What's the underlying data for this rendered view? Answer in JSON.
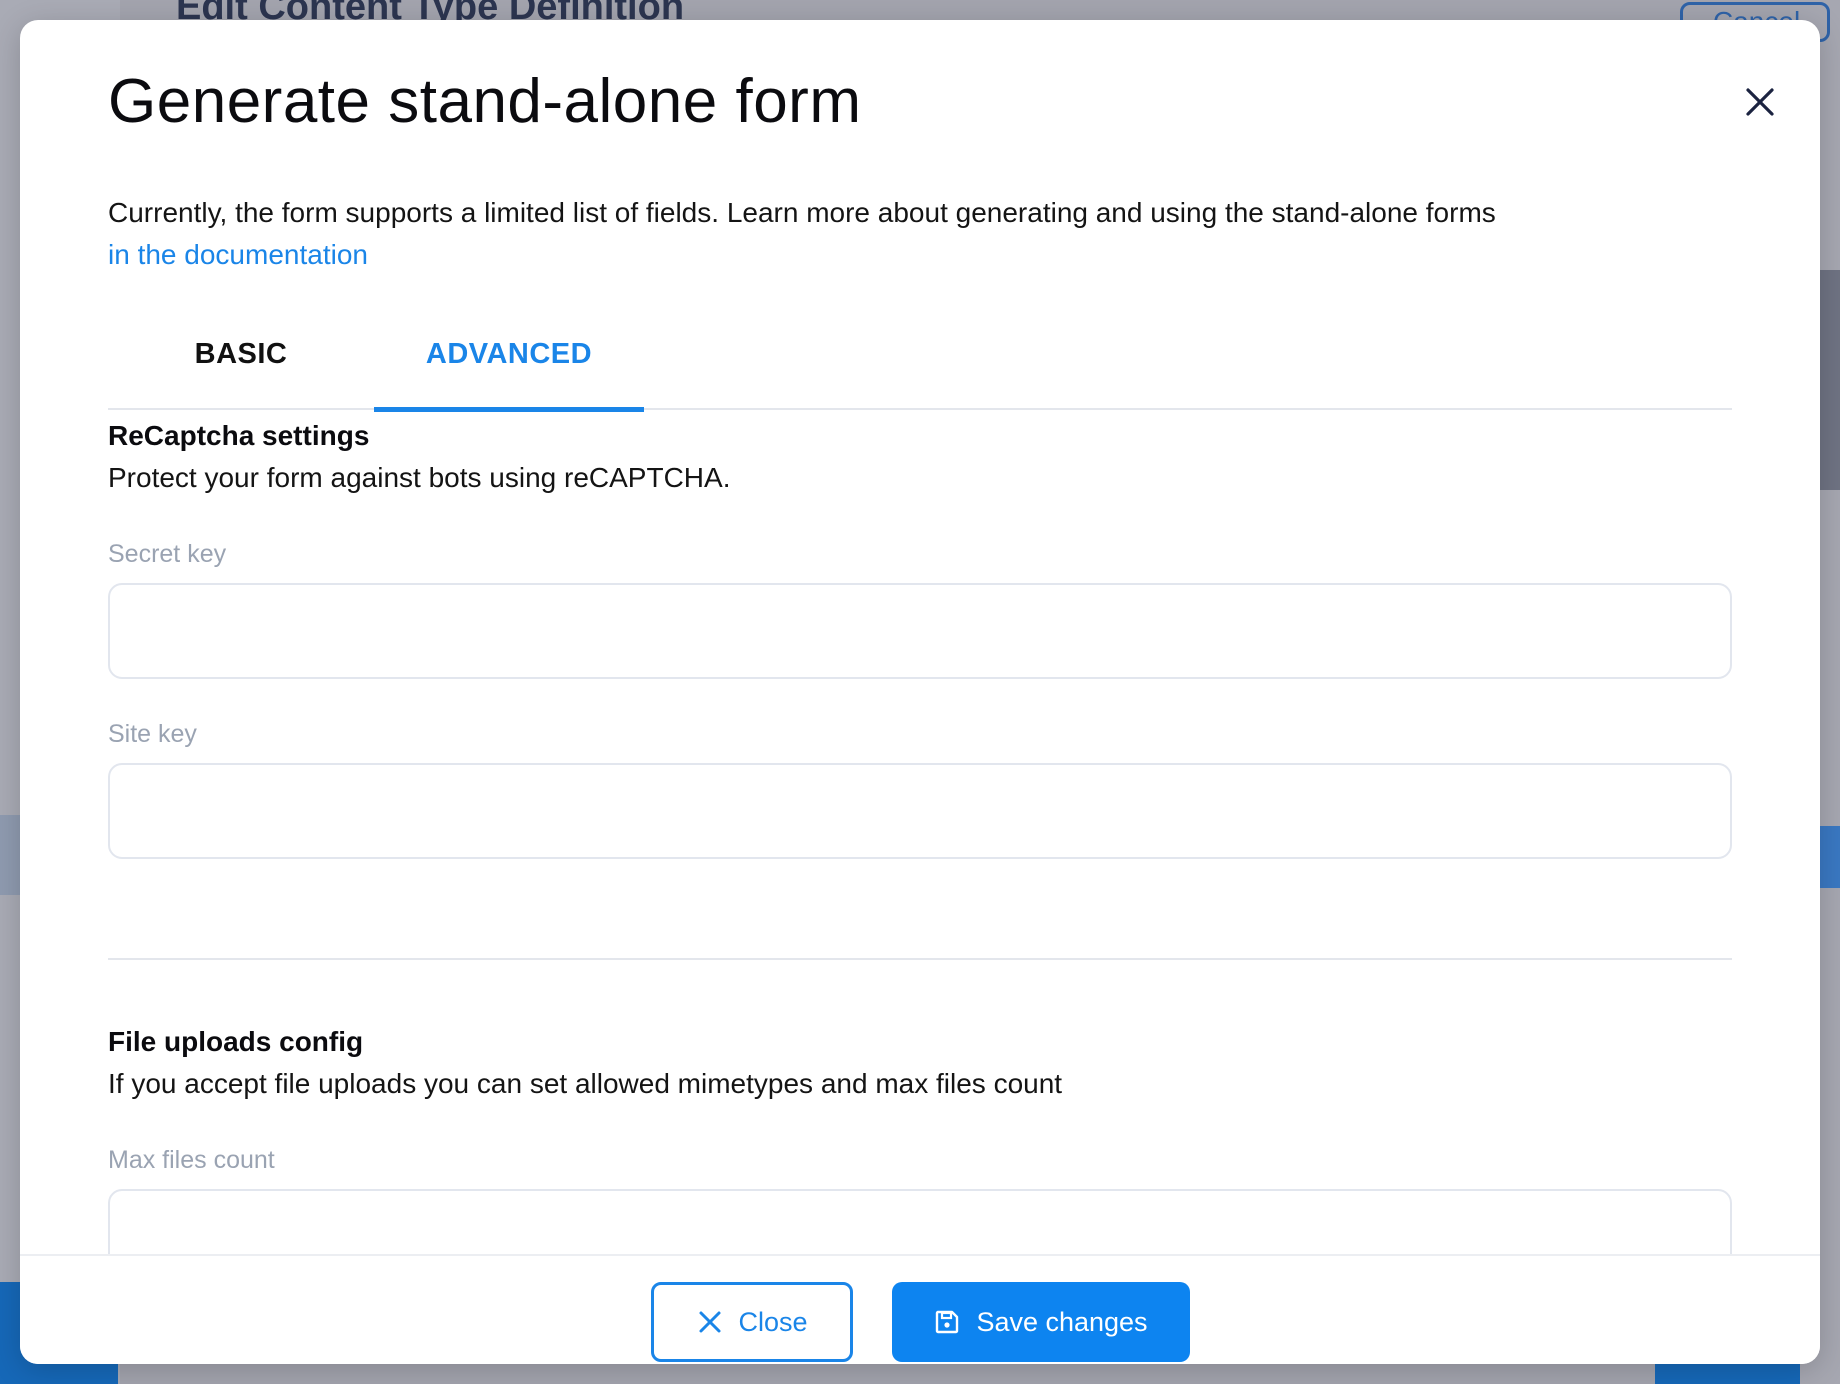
{
  "background": {
    "page_title": "Edit Content Type Definition",
    "cancel_label": "Cancel"
  },
  "modal": {
    "title": "Generate stand-alone form",
    "close_icon": "close-icon",
    "intro_text": "Currently, the form supports a limited list of fields. Learn more about generating and using the stand-alone forms",
    "intro_link": "in the documentation",
    "tabs": [
      {
        "label": "BASIC",
        "active": false
      },
      {
        "label": "ADVANCED",
        "active": true
      }
    ],
    "recaptcha": {
      "title": "ReCaptcha settings",
      "description": "Protect your form against bots using reCAPTCHA.",
      "secret_key_label": "Secret key",
      "secret_key_value": "",
      "site_key_label": "Site key",
      "site_key_value": ""
    },
    "file_uploads": {
      "title": "File uploads config",
      "description": "If you accept file uploads you can set allowed mimetypes and max files count",
      "max_files_label": "Max files count",
      "max_files_value": ""
    },
    "footer": {
      "close_label": "Close",
      "save_label": "Save changes"
    }
  },
  "colors": {
    "accent": "#1a85e8",
    "primary_button": "#0d84f0",
    "label_muted": "#9aa3b2"
  }
}
